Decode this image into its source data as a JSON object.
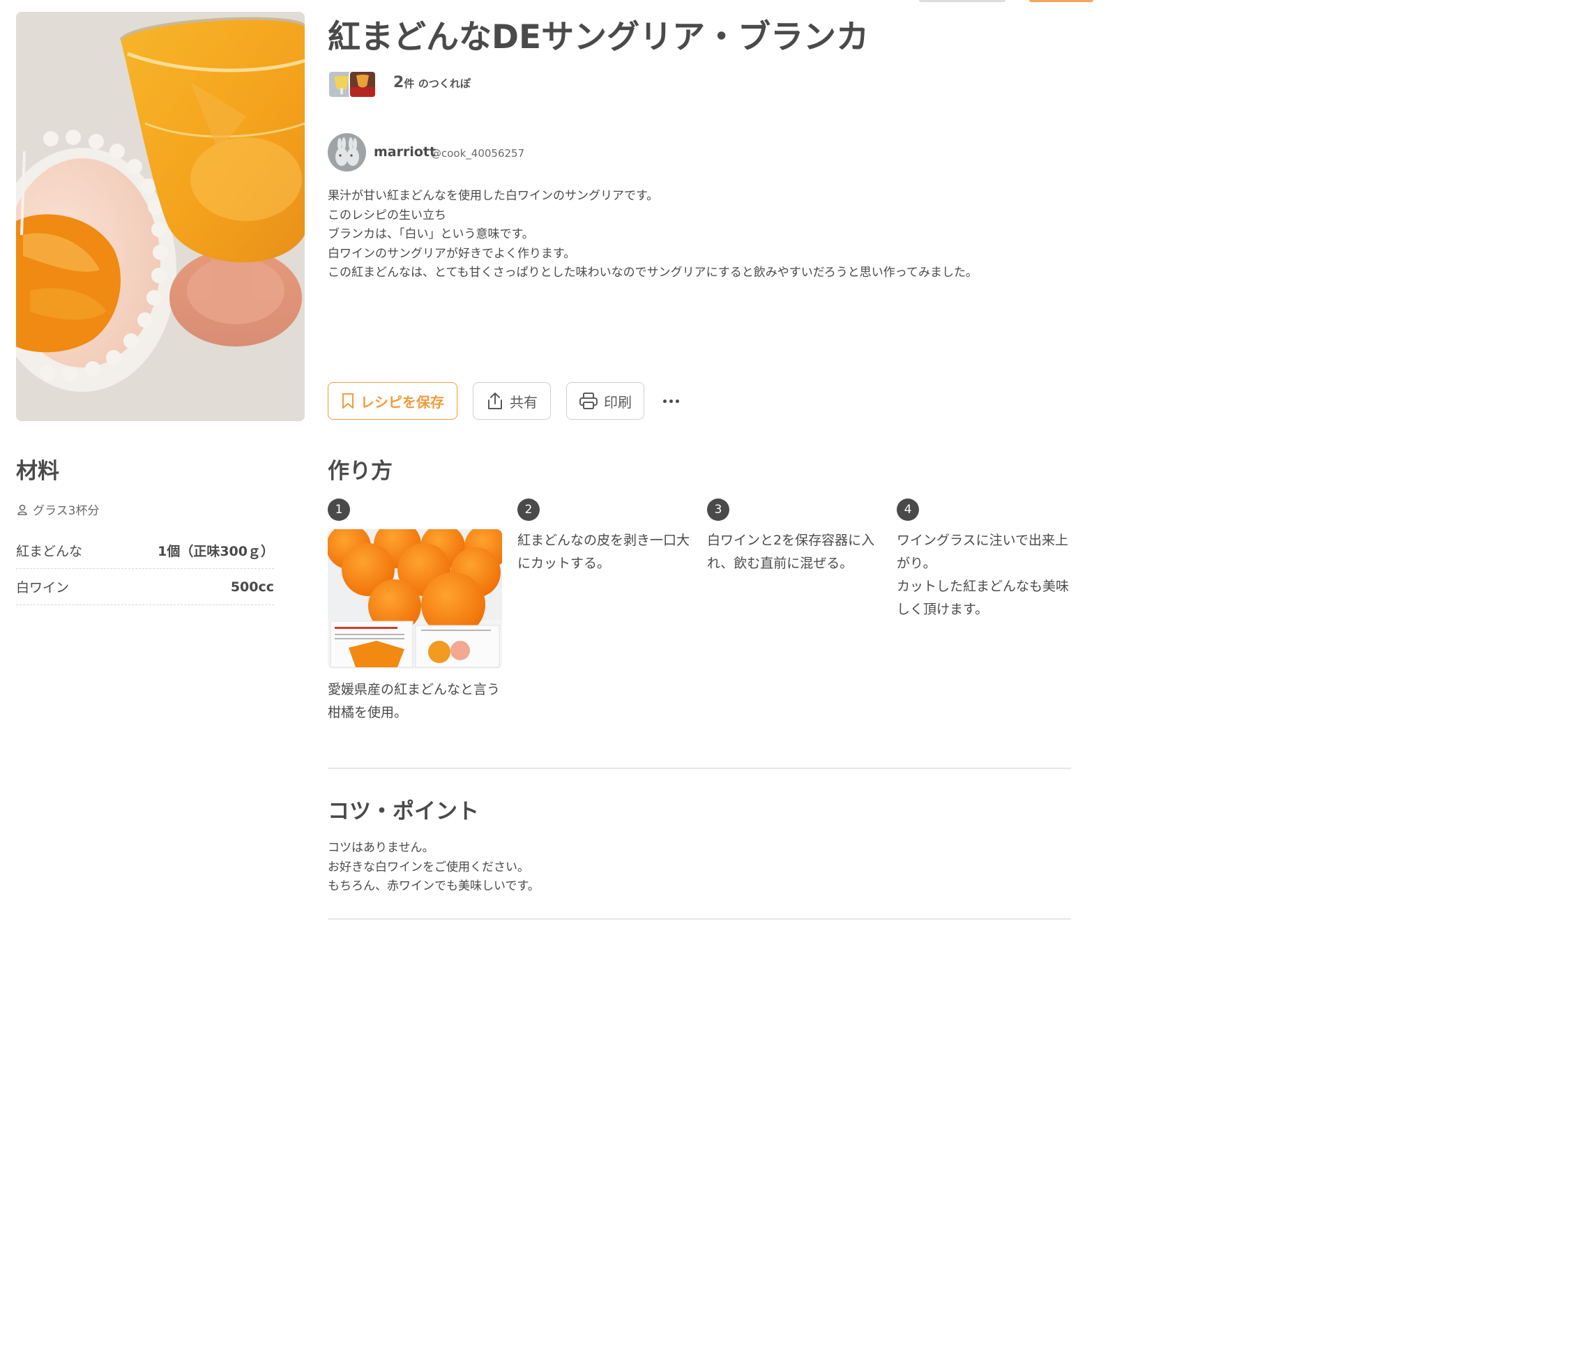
{
  "recipe": {
    "title": "紅まどんなDEサングリア・ブランカ",
    "hero_image": "sangria-photo"
  },
  "tsukurepo": {
    "count": "2",
    "unit": "件",
    "label": "のつくれぽ"
  },
  "author": {
    "name": "marriott",
    "handle": "@cook_40056257"
  },
  "description": [
    "果汁が甘い紅まどんなを使用した白ワインのサングリアです。",
    "このレシピの生い立ち",
    "ブランカは、「白い」という意味です。",
    "白ワインのサングリアが好きでよく作ります。",
    "この紅まどんなは、とても甘くさっぱりとした味わいなのでサングリアにすると飲みやすいだろうと思い作ってみました。"
  ],
  "actions": {
    "save": "レシピを保存",
    "share": "共有",
    "print": "印刷",
    "save_icon": "bookmark-icon",
    "share_icon": "share-icon",
    "print_icon": "printer-icon",
    "more_icon": "more-icon"
  },
  "ingredients": {
    "title": "材料",
    "servings": "グラス3杯分",
    "items": [
      {
        "name": "紅まどんな",
        "qty": "1個（正味300ｇ）"
      },
      {
        "name": "白ワイン",
        "qty": "500cc"
      }
    ]
  },
  "steps": {
    "title": "作り方",
    "items": [
      {
        "num": "1",
        "text": "愛媛県産の紅まどんなと言う柑橘を使用。",
        "has_photo": true
      },
      {
        "num": "2",
        "text": "紅まどんなの皮を剥き一口大にカットする。",
        "has_photo": false
      },
      {
        "num": "3",
        "text": "白ワインと2を保存容器に入れ、飲む直前に混ぜる。",
        "has_photo": false
      },
      {
        "num": "4",
        "text": "ワイングラスに注いで出来上がり。\nカットした紅まどんなも美味しく頂けます。",
        "has_photo": false
      }
    ]
  },
  "tips": {
    "title": "コツ・ポイント",
    "lines": [
      "コツはありません。",
      "お好きな白ワインをご使用ください。",
      "もちろん、赤ワインでも美味しいです。"
    ]
  },
  "colors": {
    "accent": "#f39a3c",
    "text": "#4a4a4a"
  }
}
